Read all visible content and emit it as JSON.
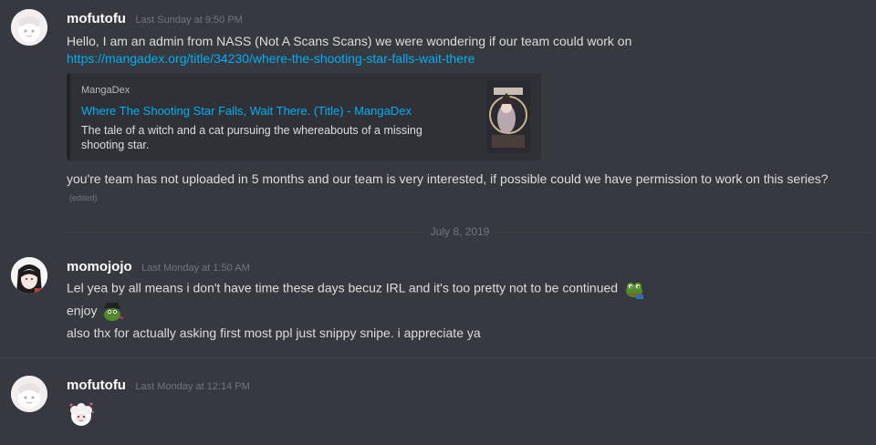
{
  "messages": [
    {
      "username": "mofutofu",
      "timestamp": "Last Sunday at 9:50 PM",
      "line1": "Hello,  I am an admin from NASS (Not A Scans Scans) we were wondering if our team could work on",
      "link": "https://mangadex.org/title/34230/where-the-shooting-star-falls-wait-there",
      "embed": {
        "provider": "MangaDex",
        "title": "Where The Shooting Star Falls, Wait There. (Title) - MangaDex",
        "description": "The tale of a witch and a cat pursuing the whereabouts of a missing shooting star."
      },
      "line2": "you're team has not uploaded in 5 months and our team is very interested, if possible could we have permission to work on this series?",
      "edited": "(edited)"
    },
    {
      "username": "momojojo",
      "timestamp": "Last Monday at 1:50 AM",
      "line1": "Lel yea by all means i don't have time these days becuz IRL and it's too pretty not to be continued",
      "line2": "enjoy",
      "line3": "also thx for actually asking first most ppl just snippy snipe. i appreciate ya"
    },
    {
      "username": "mofutofu",
      "timestamp": "Last Monday at 12:14 PM"
    }
  ],
  "date_divider": "July 8, 2019",
  "colors": {
    "background": "#36393f",
    "link": "#00b0f4",
    "username": "#ffffff",
    "timestamp": "#72767d",
    "embed_bg": "#2f3136"
  },
  "icons": [
    "avatar-mofutofu",
    "avatar-momojojo",
    "pepe-emoji",
    "pepe-hat-emoji",
    "sheep-emoji"
  ]
}
